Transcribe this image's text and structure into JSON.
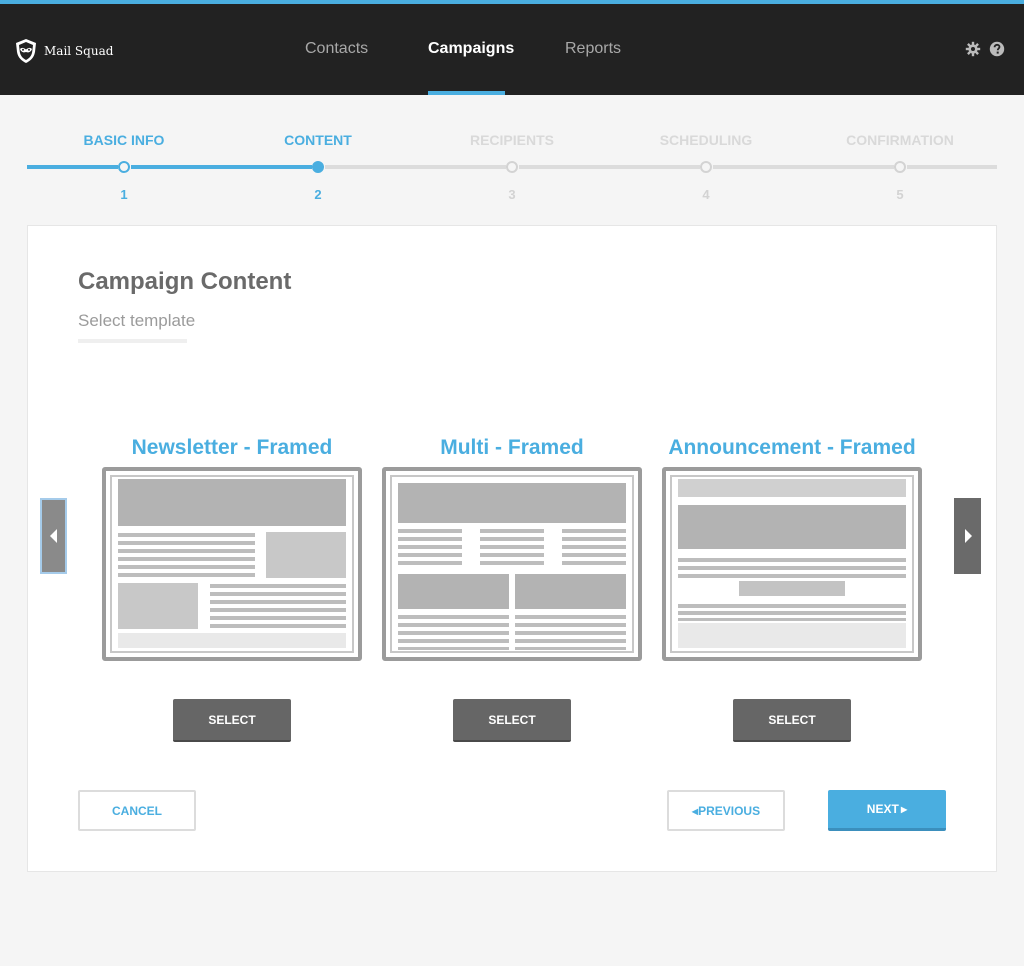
{
  "app": {
    "brand": "Mail Squad"
  },
  "nav": {
    "items": [
      {
        "label": "Contacts"
      },
      {
        "label": "Campaigns",
        "active": true
      },
      {
        "label": "Reports"
      }
    ]
  },
  "stepper": {
    "steps": [
      {
        "label": "BASIC INFO",
        "number": "1",
        "state": "done"
      },
      {
        "label": "CONTENT",
        "number": "2",
        "state": "current"
      },
      {
        "label": "RECIPIENTS",
        "number": "3",
        "state": "pending"
      },
      {
        "label": "SCHEDULING",
        "number": "4",
        "state": "pending"
      },
      {
        "label": "CONFIRMATION",
        "number": "5",
        "state": "pending"
      }
    ]
  },
  "content": {
    "title": "Campaign Content",
    "subtitle": "Select template"
  },
  "templates": [
    {
      "name": "Newsletter - Framed",
      "select_label": "SELECT"
    },
    {
      "name": "Multi - Framed",
      "select_label": "SELECT"
    },
    {
      "name": "Announcement - Framed",
      "select_label": "SELECT"
    }
  ],
  "footer": {
    "cancel_label": "CANCEL",
    "previous_label": "PREVIOUS",
    "next_label": "NEXT"
  },
  "colors": {
    "accent": "#4aaee0",
    "topbar": "#222222",
    "select_button": "#666666"
  },
  "icons": [
    "shield-logo-icon",
    "gear-icon",
    "help-icon",
    "chevron-left-icon",
    "chevron-right-icon"
  ]
}
